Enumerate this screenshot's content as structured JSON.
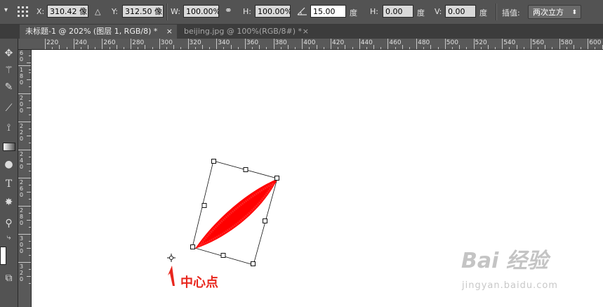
{
  "options_bar": {
    "x_label": "X:",
    "x_value": "310.42 像",
    "delta_label": "△",
    "y_label": "Y:",
    "y_value": "312.50 像",
    "w_label": "W:",
    "w_value": "100.00%",
    "h_label": "H:",
    "h_value": "100.00%",
    "angle_value": "15.00",
    "angle_unit": "度",
    "hskew_label": "H:",
    "hskew_value": "0.00",
    "hskew_unit": "度",
    "vskew_label": "V:",
    "vskew_value": "0.00",
    "vskew_unit": "度",
    "interp_label": "插值:",
    "interp_value": "两次立方"
  },
  "tabs": [
    {
      "label": "未标题-1 @ 202% (图层 1, RGB/8) *",
      "close": "×",
      "active": true
    },
    {
      "label": "beijing.jpg @ 100%(RGB/8#) *",
      "close": "×",
      "active": false
    }
  ],
  "ruler": {
    "h_labels": [
      "220",
      "240",
      "260",
      "280",
      "300",
      "320",
      "340",
      "360",
      "380",
      "400",
      "420",
      "440",
      "460",
      "480",
      "500",
      "520",
      "540",
      "560",
      "580",
      "600"
    ],
    "v_labels": [
      "60",
      "180",
      "200",
      "220",
      "240",
      "260",
      "280",
      "300",
      "320"
    ]
  },
  "tools": [
    "move-icon",
    "magic-wand-icon",
    "eyedropper-icon",
    "brush-icon",
    "history-brush-icon",
    "gradient-icon",
    "burn-icon",
    "type-icon",
    "shape-icon",
    "zoom-icon",
    "swap-colors-icon",
    "color-swatch-icon",
    "screen-mode-icon"
  ],
  "annotation": {
    "label": "中心点",
    "color": "#e8261d"
  },
  "watermark": {
    "text": "Bai 经验",
    "sub": "jingyan.baidu.com"
  },
  "colors": {
    "shape": "#ff0000",
    "canvas": "#ffffff",
    "panel": "#535353"
  }
}
